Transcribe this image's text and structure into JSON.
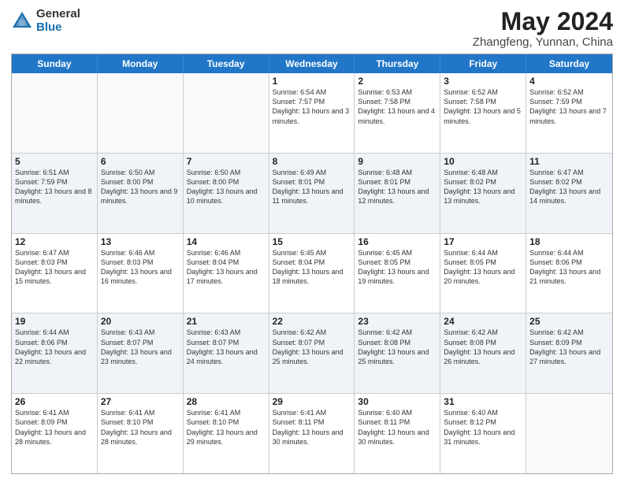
{
  "header": {
    "logo_general": "General",
    "logo_blue": "Blue",
    "title": "May 2024",
    "subtitle": "Zhangfeng, Yunnan, China"
  },
  "days_of_week": [
    "Sunday",
    "Monday",
    "Tuesday",
    "Wednesday",
    "Thursday",
    "Friday",
    "Saturday"
  ],
  "weeks": [
    [
      {
        "day": "",
        "info": "",
        "empty": true
      },
      {
        "day": "",
        "info": "",
        "empty": true
      },
      {
        "day": "",
        "info": "",
        "empty": true
      },
      {
        "day": "1",
        "info": "Sunrise: 6:54 AM\nSunset: 7:57 PM\nDaylight: 13 hours and 3 minutes."
      },
      {
        "day": "2",
        "info": "Sunrise: 6:53 AM\nSunset: 7:58 PM\nDaylight: 13 hours and 4 minutes."
      },
      {
        "day": "3",
        "info": "Sunrise: 6:52 AM\nSunset: 7:58 PM\nDaylight: 13 hours and 5 minutes."
      },
      {
        "day": "4",
        "info": "Sunrise: 6:52 AM\nSunset: 7:59 PM\nDaylight: 13 hours and 7 minutes."
      }
    ],
    [
      {
        "day": "5",
        "info": "Sunrise: 6:51 AM\nSunset: 7:59 PM\nDaylight: 13 hours and 8 minutes."
      },
      {
        "day": "6",
        "info": "Sunrise: 6:50 AM\nSunset: 8:00 PM\nDaylight: 13 hours and 9 minutes."
      },
      {
        "day": "7",
        "info": "Sunrise: 6:50 AM\nSunset: 8:00 PM\nDaylight: 13 hours and 10 minutes."
      },
      {
        "day": "8",
        "info": "Sunrise: 6:49 AM\nSunset: 8:01 PM\nDaylight: 13 hours and 11 minutes."
      },
      {
        "day": "9",
        "info": "Sunrise: 6:48 AM\nSunset: 8:01 PM\nDaylight: 13 hours and 12 minutes."
      },
      {
        "day": "10",
        "info": "Sunrise: 6:48 AM\nSunset: 8:02 PM\nDaylight: 13 hours and 13 minutes."
      },
      {
        "day": "11",
        "info": "Sunrise: 6:47 AM\nSunset: 8:02 PM\nDaylight: 13 hours and 14 minutes."
      }
    ],
    [
      {
        "day": "12",
        "info": "Sunrise: 6:47 AM\nSunset: 8:03 PM\nDaylight: 13 hours and 15 minutes."
      },
      {
        "day": "13",
        "info": "Sunrise: 6:46 AM\nSunset: 8:03 PM\nDaylight: 13 hours and 16 minutes."
      },
      {
        "day": "14",
        "info": "Sunrise: 6:46 AM\nSunset: 8:04 PM\nDaylight: 13 hours and 17 minutes."
      },
      {
        "day": "15",
        "info": "Sunrise: 6:45 AM\nSunset: 8:04 PM\nDaylight: 13 hours and 18 minutes."
      },
      {
        "day": "16",
        "info": "Sunrise: 6:45 AM\nSunset: 8:05 PM\nDaylight: 13 hours and 19 minutes."
      },
      {
        "day": "17",
        "info": "Sunrise: 6:44 AM\nSunset: 8:05 PM\nDaylight: 13 hours and 20 minutes."
      },
      {
        "day": "18",
        "info": "Sunrise: 6:44 AM\nSunset: 8:06 PM\nDaylight: 13 hours and 21 minutes."
      }
    ],
    [
      {
        "day": "19",
        "info": "Sunrise: 6:44 AM\nSunset: 8:06 PM\nDaylight: 13 hours and 22 minutes."
      },
      {
        "day": "20",
        "info": "Sunrise: 6:43 AM\nSunset: 8:07 PM\nDaylight: 13 hours and 23 minutes."
      },
      {
        "day": "21",
        "info": "Sunrise: 6:43 AM\nSunset: 8:07 PM\nDaylight: 13 hours and 24 minutes."
      },
      {
        "day": "22",
        "info": "Sunrise: 6:42 AM\nSunset: 8:07 PM\nDaylight: 13 hours and 25 minutes."
      },
      {
        "day": "23",
        "info": "Sunrise: 6:42 AM\nSunset: 8:08 PM\nDaylight: 13 hours and 25 minutes."
      },
      {
        "day": "24",
        "info": "Sunrise: 6:42 AM\nSunset: 8:08 PM\nDaylight: 13 hours and 26 minutes."
      },
      {
        "day": "25",
        "info": "Sunrise: 6:42 AM\nSunset: 8:09 PM\nDaylight: 13 hours and 27 minutes."
      }
    ],
    [
      {
        "day": "26",
        "info": "Sunrise: 6:41 AM\nSunset: 8:09 PM\nDaylight: 13 hours and 28 minutes."
      },
      {
        "day": "27",
        "info": "Sunrise: 6:41 AM\nSunset: 8:10 PM\nDaylight: 13 hours and 28 minutes."
      },
      {
        "day": "28",
        "info": "Sunrise: 6:41 AM\nSunset: 8:10 PM\nDaylight: 13 hours and 29 minutes."
      },
      {
        "day": "29",
        "info": "Sunrise: 6:41 AM\nSunset: 8:11 PM\nDaylight: 13 hours and 30 minutes."
      },
      {
        "day": "30",
        "info": "Sunrise: 6:40 AM\nSunset: 8:11 PM\nDaylight: 13 hours and 30 minutes."
      },
      {
        "day": "31",
        "info": "Sunrise: 6:40 AM\nSunset: 8:12 PM\nDaylight: 13 hours and 31 minutes."
      },
      {
        "day": "",
        "info": "",
        "empty": true
      }
    ]
  ]
}
